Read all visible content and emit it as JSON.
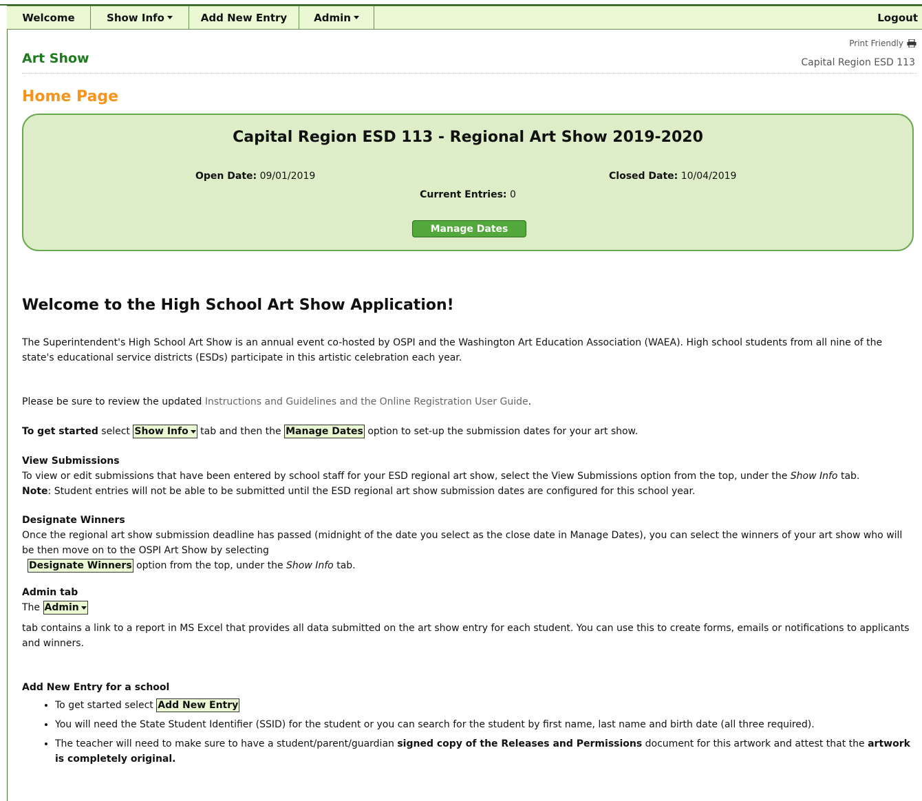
{
  "nav": {
    "welcome": "Welcome",
    "show_info": "Show Info",
    "add_new_entry": "Add New Entry",
    "admin": "Admin",
    "logout": "Logout"
  },
  "header": {
    "app_title": "Art Show",
    "print_friendly": "Print Friendly",
    "org_name": "Capital Region ESD 113"
  },
  "page_heading": "Home Page",
  "show": {
    "title": "Capital Region ESD 113 - Regional Art Show 2019-2020",
    "open_label": "Open Date:",
    "open_value": "09/01/2019",
    "closed_label": "Closed Date:",
    "closed_value": "10/04/2019",
    "entries_label": "Current Entries:",
    "entries_value": "0",
    "manage_button": "Manage Dates"
  },
  "welcome": {
    "heading": "Welcome to the High School Art Show Application!",
    "intro": "The Superintendent's High School Art Show is an annual event co-hosted by OSPI and the Washington Art Education Association (WAEA). High school students from all nine of the state's educational service districts (ESDs) participate in this artistic celebration each year.",
    "review_prefix": "Please be sure to review the updated ",
    "review_link": "Instructions and Guidelines and the Online Registration User Guide",
    "review_suffix": ".",
    "get_started_bold": "To get started",
    "get_started_1": " select ",
    "chip_show_info": "Show Info",
    "get_started_2": " tab and then the ",
    "chip_manage_dates": "Manage Dates",
    "get_started_3": " option to set-up the submission dates for your art show."
  },
  "view_submissions": {
    "heading": "View Submissions",
    "text_1": "To view or edit submissions that have been entered by school staff for your ESD regional art show, select the View Submissions option from the top, under the ",
    "text_em": "Show Info",
    "text_2": " tab.",
    "note_label": "Note",
    "note_text": ": Student entries will not be able to be submitted until the ESD regional art show submission dates are configured for this school year."
  },
  "designate_winners": {
    "heading": "Designate Winners",
    "text_1": "Once the regional art show submission deadline has passed (midnight of the date you select as the close date in Manage Dates), you can select the winners of your art show who will be then move on to the OSPI Art Show by selecting",
    "chip": "Designate Winners",
    "text_2": " option from the top, under the ",
    "text_em": "Show Info",
    "text_3": " tab."
  },
  "admin_tab": {
    "heading": "Admin tab",
    "prefix": "The ",
    "chip": "Admin",
    "text": "tab contains a link to a report in MS Excel that provides all data submitted on the art show entry for each student. You can use this to create forms, emails or notifications to applicants and winners."
  },
  "add_entry": {
    "heading": "Add New Entry for a school",
    "item1_prefix": "To get started select ",
    "item1_chip": "Add New Entry",
    "item2": "You will need the State Student Identifier (SSID) for the student or you can search for the student by first name, last name and birth date (all three required).",
    "item3_1": "The teacher will need to make sure to have a student/parent/guardian ",
    "item3_bold": "signed copy of the Releases and Permissions",
    "item3_2": " document for this artwork and attest that the ",
    "item3_bold2": "artwork is completely original."
  }
}
